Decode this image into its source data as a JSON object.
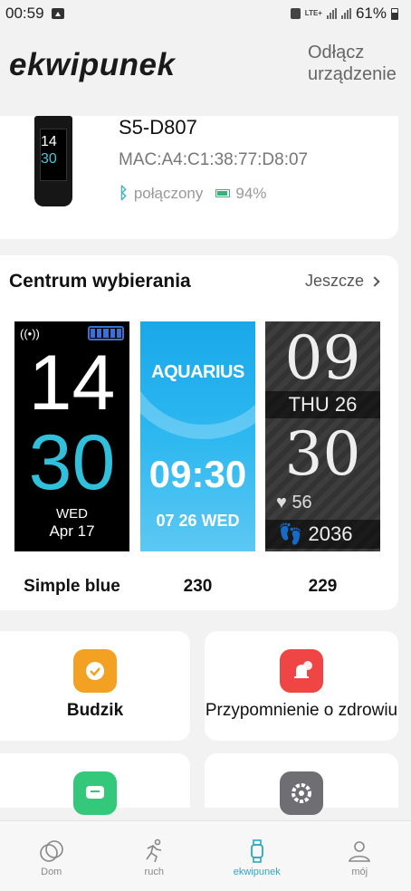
{
  "status_bar": {
    "time": "00:59",
    "network": "LTE+",
    "battery_percent": "61%"
  },
  "header": {
    "title": "ekwipunek",
    "disconnect_label": "Odłącz urządzenie"
  },
  "device": {
    "name": "S5-D807",
    "mac": "MAC:A4:C1:38:77:D8:07",
    "connection_status": "połączony",
    "battery": "94%",
    "preview_hour": "14",
    "preview_minute": "30"
  },
  "dial_center": {
    "title": "Centrum wybierania",
    "more_label": "Jeszcze",
    "faces": [
      {
        "label": "Simple blue",
        "hour": "14",
        "minute": "30",
        "day": "WED",
        "date": "Apr 17"
      },
      {
        "label": "230",
        "brand": "AQUARIUS",
        "time": "09:30",
        "date": "07 26 WED"
      },
      {
        "label": "229",
        "hour": "09",
        "day": "THU 26",
        "minute": "30",
        "heart_rate": "56",
        "steps": "2036"
      }
    ]
  },
  "tiles": [
    {
      "label": "Budzik",
      "icon": "alarm-clock-icon",
      "color": "#f3a122"
    },
    {
      "label": "Przypomnienie o zdrowiu",
      "icon": "health-reminder-icon",
      "color": "#ef4545"
    },
    {
      "label": "",
      "icon": "message-icon",
      "color": "#34c97a"
    },
    {
      "label": "",
      "icon": "settings-icon",
      "color": "#6e6e73"
    }
  ],
  "nav": {
    "items": [
      {
        "label": "Dom",
        "icon": "home-icon"
      },
      {
        "label": "ruch",
        "icon": "running-icon"
      },
      {
        "label": "ekwipunek",
        "icon": "watch-icon",
        "active": true
      },
      {
        "label": "mój",
        "icon": "profile-icon"
      }
    ],
    "active_color": "#2aa8c4"
  }
}
